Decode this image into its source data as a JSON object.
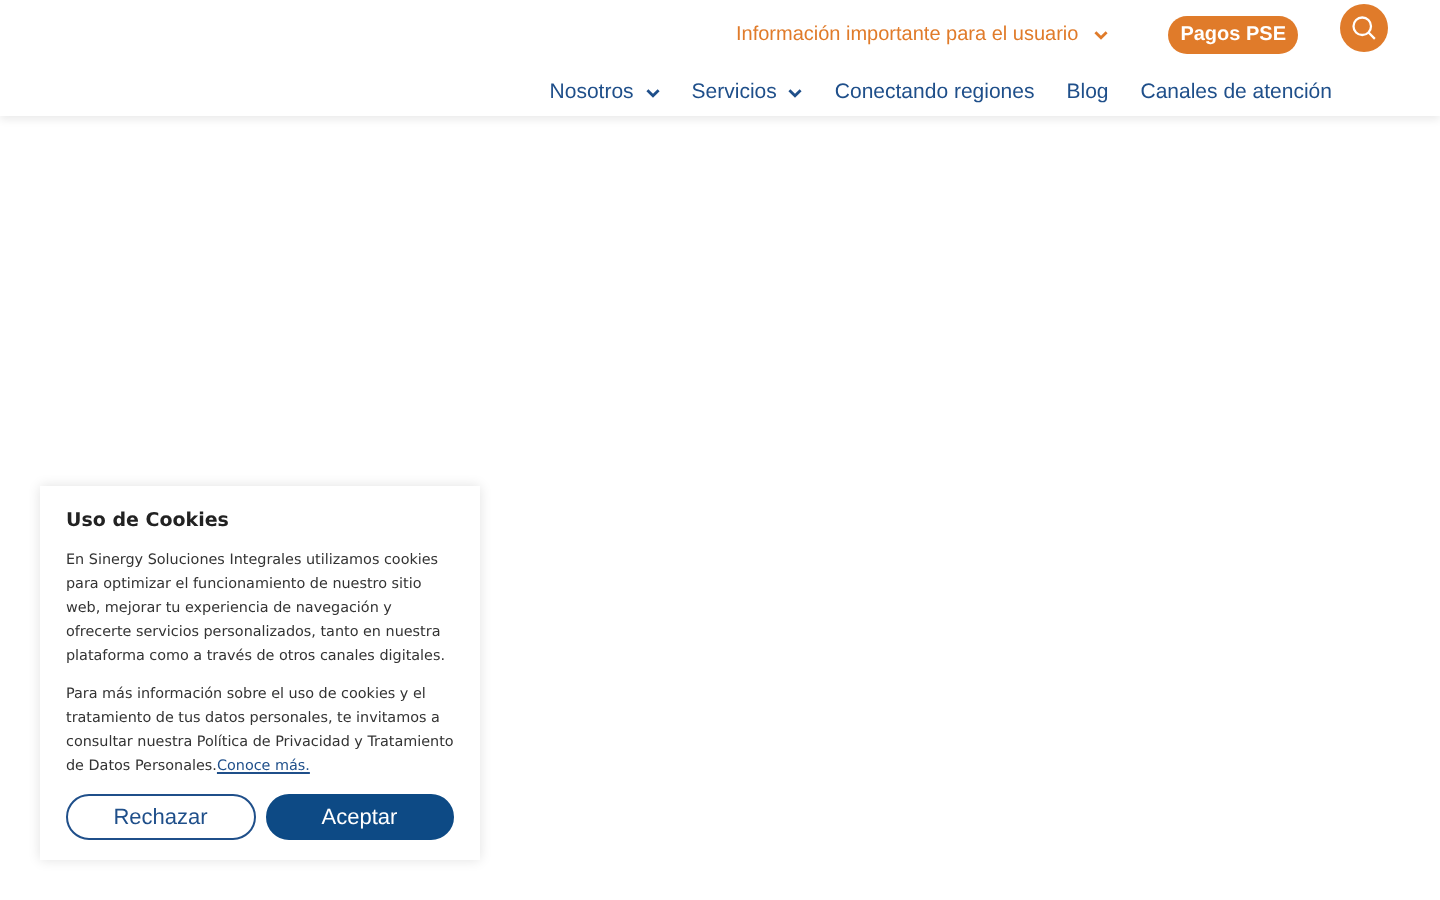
{
  "header": {
    "info_link": {
      "label": "Información importante para el usuario",
      "has_menu": true
    },
    "pse_button": "Pagos PSE",
    "nav": [
      {
        "label": "Nosotros",
        "has_menu": true
      },
      {
        "label": "Servicios",
        "has_menu": true
      },
      {
        "label": "Conectando regiones",
        "has_menu": false
      },
      {
        "label": "Blog",
        "has_menu": false
      },
      {
        "label": "Canales de atención",
        "has_menu": false
      }
    ]
  },
  "cookie_banner": {
    "title": "Uso de Cookies",
    "paragraphs": [
      "En Sinergy Soluciones Integrales utilizamos cookies para optimizar el funcionamiento de nuestro sitio web, mejorar tu experiencia de navegación y ofrecerte servicios personalizados, tanto en nuestra plataforma como a través de otros canales digitales.",
      "Para más información sobre el uso de cookies y el tratamiento de tus datos personales, te invitamos a consultar nuestra Política de Privacidad y Tratamiento de Datos Personales."
    ],
    "link": "Conoce más.",
    "buttons": [
      {
        "label": "Rechazar",
        "kind": "outline"
      },
      {
        "label": "Aceptar",
        "kind": "primary"
      }
    ]
  }
}
